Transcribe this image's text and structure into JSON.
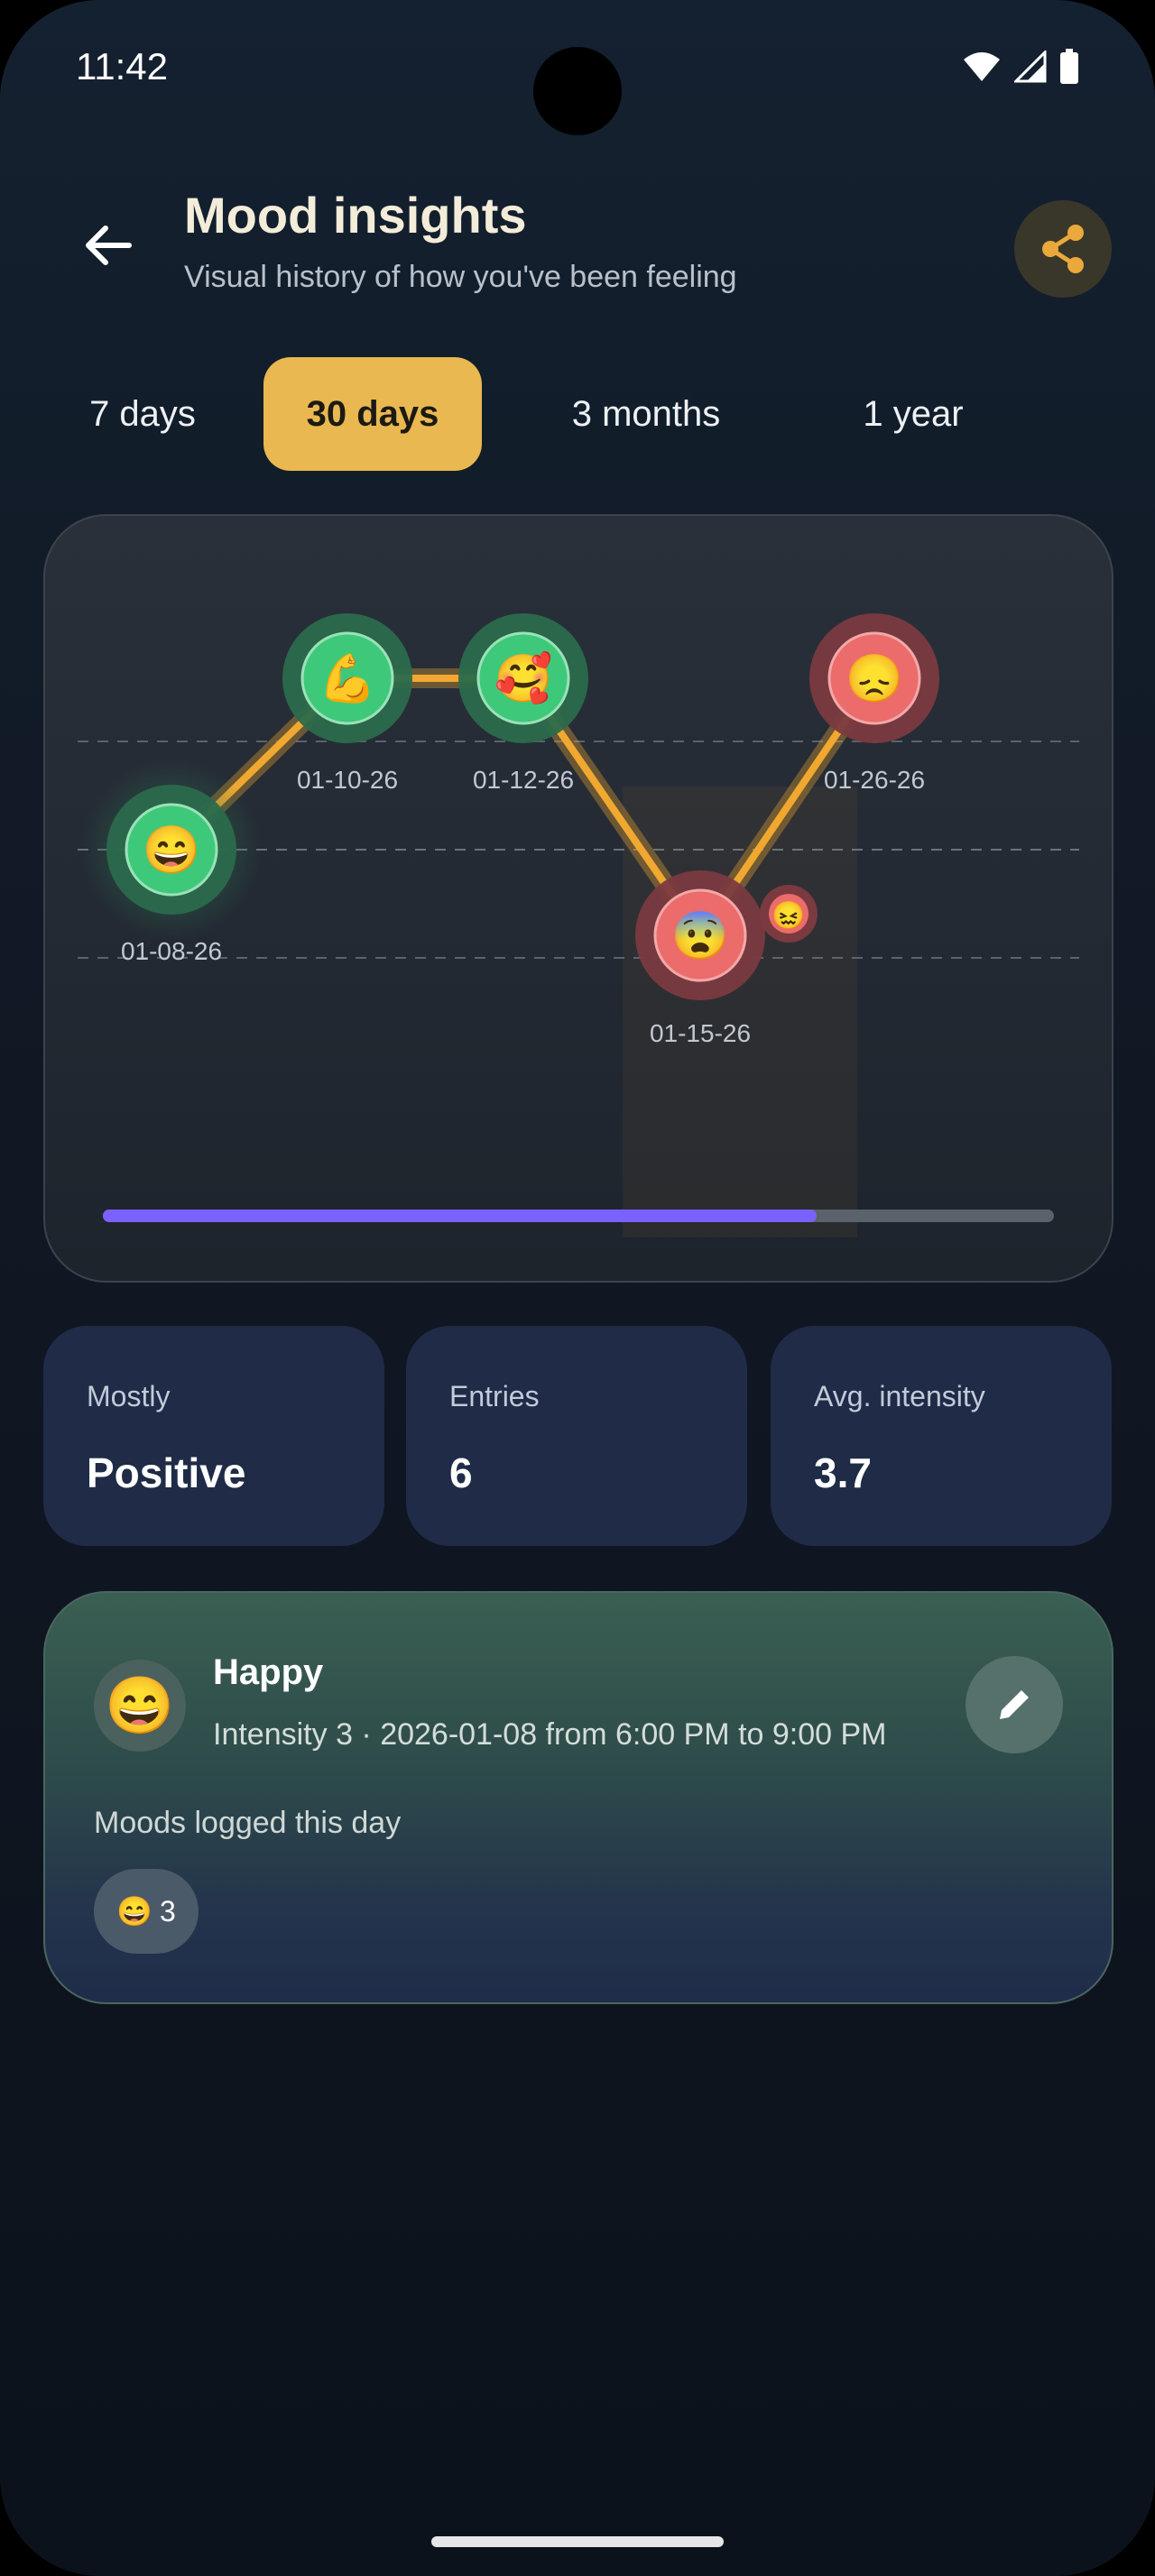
{
  "status_bar": {
    "time": "11:42"
  },
  "header": {
    "title": "Mood insights",
    "subtitle": "Visual history of how you've been feeling"
  },
  "tabs": [
    {
      "label": "7 days",
      "active": false
    },
    {
      "label": "30 days",
      "active": true
    },
    {
      "label": "3 months",
      "active": false
    },
    {
      "label": "1 year",
      "active": false
    }
  ],
  "chart_data": {
    "type": "line",
    "points": [
      {
        "date": "01-08-26",
        "mood": "happy",
        "emoji": "😄",
        "tone": "positive",
        "level": 1
      },
      {
        "date": "01-10-26",
        "mood": "strong",
        "emoji": "💪",
        "tone": "positive",
        "level": 2
      },
      {
        "date": "01-12-26",
        "mood": "loved",
        "emoji": "🥰",
        "tone": "positive",
        "level": 2
      },
      {
        "date": "01-15-26",
        "mood": "anxious",
        "emoji": "😨",
        "tone": "negative",
        "level": 0.5,
        "extra_emoji": "😖"
      },
      {
        "date": "01-26-26",
        "mood": "sad",
        "emoji": "😞",
        "tone": "negative",
        "level": 2
      }
    ],
    "scroll_progress": 0.75
  },
  "stats": [
    {
      "label": "Mostly",
      "value": "Positive"
    },
    {
      "label": "Entries",
      "value": "6"
    },
    {
      "label": "Avg. intensity",
      "value": "3.7"
    }
  ],
  "detail": {
    "emoji": "😄",
    "name": "Happy",
    "meta": "Intensity 3 · 2026-01-08 from 6:00 PM to 9:00 PM",
    "logged_label": "Moods logged this day",
    "chip_emoji": "😄",
    "chip_count": "3"
  },
  "colors": {
    "accent": "#e9b850",
    "positive": "#3ec97a",
    "negative": "#ec6b6b",
    "line": "#f0a830",
    "scroll": "#7b61ff"
  }
}
